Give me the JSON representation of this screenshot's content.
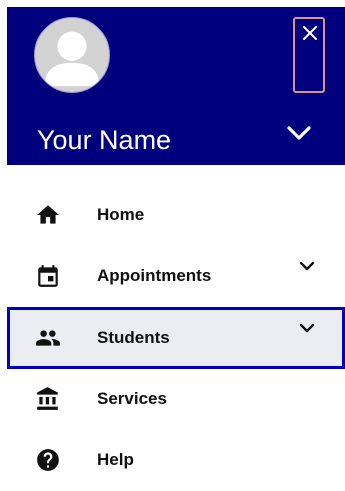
{
  "user": {
    "name": "Your Name"
  },
  "colors": {
    "header_bg": "#00007f",
    "selected_border": "#0000c8",
    "selected_bg": "#ececf3",
    "close_border": "#d9928c"
  },
  "nav": {
    "items": [
      {
        "label": "Home",
        "icon": "home-icon",
        "expandable": false,
        "selected": false
      },
      {
        "label": "Appointments",
        "icon": "calendar-icon",
        "expandable": true,
        "selected": false
      },
      {
        "label": "Students",
        "icon": "people-icon",
        "expandable": true,
        "selected": true
      },
      {
        "label": "Services",
        "icon": "bank-icon",
        "expandable": false,
        "selected": false
      },
      {
        "label": "Help",
        "icon": "help-circle-icon",
        "expandable": false,
        "selected": false
      }
    ]
  }
}
